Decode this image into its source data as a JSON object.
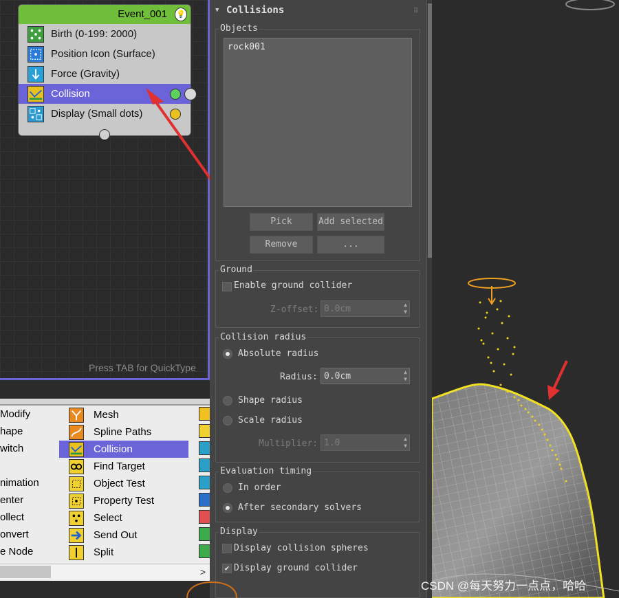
{
  "event": {
    "title": "Event_001",
    "operators": [
      {
        "label": "Birth (0-199: 2000)",
        "icon": "birth-icon"
      },
      {
        "label": "Position Icon (Surface)",
        "icon": "position-icon"
      },
      {
        "label": "Force (Gravity)",
        "icon": "force-icon"
      },
      {
        "label": "Collision",
        "icon": "collision-icon",
        "selected": true
      },
      {
        "label": "Display (Small dots)",
        "icon": "display-icon"
      }
    ]
  },
  "hint": "Press TAB for QuickType",
  "depot": {
    "left_items": [
      "Modify",
      "hape",
      "witch",
      "nimation",
      "enter",
      "ollect",
      "onvert",
      "e Node"
    ],
    "items": [
      {
        "label": "Mesh"
      },
      {
        "label": "Spline Paths"
      },
      {
        "label": "Collision",
        "selected": true
      },
      {
        "label": "Find Target"
      },
      {
        "label": "Object Test"
      },
      {
        "label": "Property Test"
      },
      {
        "label": "Select"
      },
      {
        "label": "Send Out"
      },
      {
        "label": "Split"
      }
    ],
    "scroll_right_glyph": ">"
  },
  "panel": {
    "title": "Collisions",
    "objects_label": "Objects",
    "objects": [
      "rock001"
    ],
    "pick": "Pick",
    "add_selected": "Add selected",
    "remove": "Remove",
    "more": "...",
    "ground": {
      "label": "Ground",
      "enable": "Enable ground collider",
      "zoffset_label": "Z-offset:",
      "zoffset_value": "0.0cm"
    },
    "radius": {
      "label": "Collision radius",
      "absolute": "Absolute radius",
      "radius_label": "Radius:",
      "radius_value": "0.0cm",
      "shape": "Shape radius",
      "scale": "Scale radius",
      "multiplier_label": "Multiplier:",
      "multiplier_value": "1.0"
    },
    "timing": {
      "label": "Evaluation timing",
      "in_order": "In order",
      "after": "After secondary solvers"
    },
    "display": {
      "label": "Display",
      "spheres": "Display collision spheres",
      "ground": "Display ground collider"
    }
  },
  "watermark": "CSDN @每天努力一点点，哈哈",
  "colors": {
    "event_header": "#6fbf3a",
    "selection": "#6a64d8",
    "arrow": "#e03030",
    "particles": "#f0d020"
  }
}
